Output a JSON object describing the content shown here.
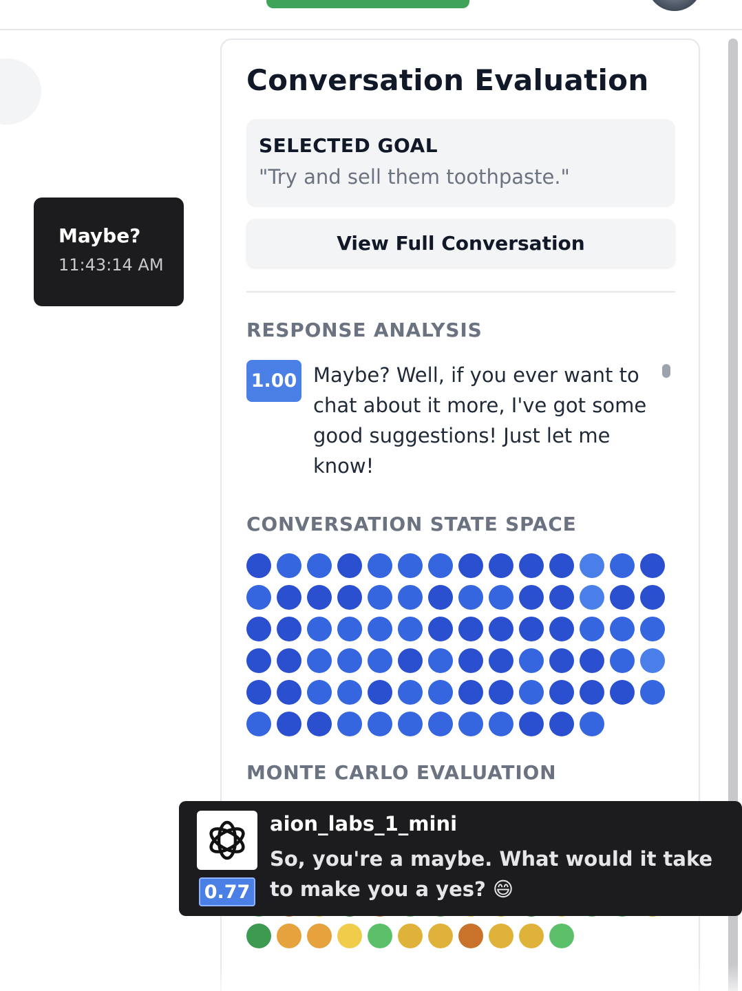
{
  "message": {
    "text": "Maybe?",
    "time": "11:43:14 AM"
  },
  "panel": {
    "title": "Conversation Evaluation",
    "goal_heading": "SELECTED GOAL",
    "goal_text": "\"Try and sell them toothpaste.\"",
    "view_button": "View Full Conversation",
    "response_heading": "RESPONSE ANALYSIS",
    "response_score": "1.00",
    "response_text": "Maybe? Well, if you ever want to chat about it more, I've got some good suggestions! Just let me know!",
    "state_heading": "CONVERSATION STATE SPACE",
    "monte_heading": "MONTE CARLO EVALUATION"
  },
  "colors": {
    "blue_dark": "#2a4fcf",
    "blue_mid": "#3566e0",
    "blue_light": "#4a7ee8",
    "green": "#5cc06a",
    "green_dark": "#3d9a50",
    "orange": "#c9732a",
    "amber": "#e6a23c",
    "yellow": "#f0cc4a",
    "gold": "#dfb23a"
  },
  "state_dots": [
    "d",
    "m",
    "m",
    "d",
    "m",
    "m",
    "m",
    "d",
    "d",
    "d",
    "d",
    "l",
    "m",
    "d",
    "m",
    "d",
    "d",
    "d",
    "m",
    "m",
    "d",
    "m",
    "m",
    "d",
    "d",
    "l",
    "d",
    "d",
    "d",
    "d",
    "m",
    "m",
    "m",
    "m",
    "d",
    "d",
    "d",
    "d",
    "d",
    "m",
    "m",
    "m",
    "d",
    "d",
    "m",
    "m",
    "m",
    "d",
    "m",
    "d",
    "d",
    "m",
    "d",
    "d",
    "m",
    "l",
    "d",
    "d",
    "m",
    "m",
    "d",
    "m",
    "m",
    "d",
    "d",
    "m",
    "d",
    "d",
    "d",
    "m",
    "m",
    "d",
    "d",
    "m",
    "m",
    "m",
    "m",
    "m",
    "m",
    "d",
    "d",
    "m"
  ],
  "monte_dots": [
    "g",
    "o",
    "y",
    "gd",
    "o",
    "g",
    "g",
    "y",
    "gl",
    "gd",
    "y",
    "g",
    "g",
    "gl",
    "gd",
    "a",
    "a",
    "y",
    "g",
    "gl",
    "gl",
    "o",
    "gl",
    "gl",
    "g"
  ],
  "tooltip": {
    "model_name": "aion_labs_1_mini",
    "score": "0.77",
    "reply": "So, you're a maybe. What would it take to make you a yes? 😄",
    "logo_icon": "openai-icon"
  }
}
